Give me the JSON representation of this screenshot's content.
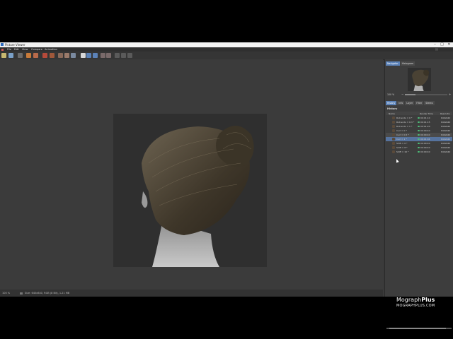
{
  "window": {
    "title": "Picture Viewer"
  },
  "menu": [
    "File",
    "Edit",
    "View",
    "Compare",
    "Animation"
  ],
  "toolbar_buttons": [
    {
      "icon": "open-icon",
      "color": "#c8b870"
    },
    {
      "icon": "save-icon",
      "color": "#7aa0c8"
    },
    {
      "icon": "save-as-icon",
      "color": "#6a6a6a"
    },
    {
      "icon": "render-icon",
      "color": "#c77a3a"
    },
    {
      "icon": "render-region-icon",
      "color": "#b86a4a"
    },
    {
      "icon": "stop-icon",
      "color": "#b64a3a"
    },
    {
      "icon": "compare-icon",
      "color": "#a0583a"
    },
    {
      "icon": "filter-icon",
      "color": "#8a6a5a"
    },
    {
      "icon": "layer-icon",
      "color": "#9a7a6a"
    },
    {
      "icon": "channel-icon",
      "color": "#7a8aa0"
    },
    {
      "icon": "fit-icon",
      "color": "#d8d8d8"
    },
    {
      "icon": "ab-a-icon",
      "color": "#5b82b8"
    },
    {
      "icon": "ab-b-icon",
      "color": "#5b82b8"
    },
    {
      "icon": "prev-frame-icon",
      "color": "#7a6a6a"
    },
    {
      "icon": "next-frame-icon",
      "color": "#7a6a6a"
    },
    {
      "icon": "play-icon",
      "color": "#5a5a5a"
    },
    {
      "icon": "loop-icon",
      "color": "#5a5a5a"
    },
    {
      "icon": "end-icon",
      "color": "#5a5a5a"
    }
  ],
  "panel": {
    "top_tabs": [
      "Navigator",
      "Histogram"
    ],
    "zoom": "100 %",
    "zoom_level": 0.25,
    "tabs": [
      "History",
      "Info",
      "Layer",
      "Filter",
      "Stereo"
    ],
    "history_title": "History",
    "columns": [
      "Name",
      "Render Time",
      "Resolutio"
    ],
    "rows": [
      {
        "name": "Roll ends = 0 *",
        "time": "00:01:10",
        "res": "640x640",
        "state": ""
      },
      {
        "name": "Roll ends = 0.3 *",
        "time": "00:01:15",
        "res": "640x640",
        "state": ""
      },
      {
        "name": "Roll ends = 1 *",
        "time": "00:01:20",
        "res": "640x640",
        "state": ""
      },
      {
        "name": "Curl = 0 *",
        "time": "00:00:40",
        "res": "640x640",
        "state": ""
      },
      {
        "name": "Curl = 0.5 *",
        "time": "00:00:40",
        "res": "640x640",
        "state": "hl"
      },
      {
        "name": "Curl = 1 *",
        "time": "00:01:04",
        "res": "640x640",
        "state": "sel"
      },
      {
        "name": "Shift = 0 *",
        "time": "00:00:40",
        "res": "640x640",
        "state": ""
      },
      {
        "name": "Shift = 8 *",
        "time": "00:00:40",
        "res": "640x640",
        "state": ""
      },
      {
        "name": "Shift = 16 *",
        "time": "00:00:40",
        "res": "640x640",
        "state": ""
      }
    ]
  },
  "logo": {
    "brand_a": "Mograph",
    "brand_b": "Plus",
    "url": "MOGRAPHPLUS.COM"
  },
  "status": {
    "zoom": "100 %",
    "info": "Size: 640x640, RGB (8 Bit), 1.21 MB"
  }
}
